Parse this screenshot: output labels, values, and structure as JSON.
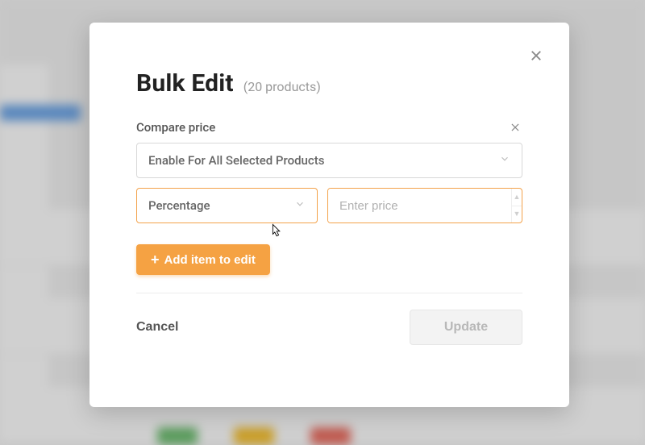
{
  "modal": {
    "title": "Bulk Edit",
    "subtitle": "(20 products)",
    "field_label": "Compare price",
    "select_main": "Enable For All Selected Products",
    "select_type": "Percentage",
    "price_placeholder": "Enter price",
    "add_item_label": "Add item to edit",
    "cancel_label": "Cancel",
    "update_label": "Update"
  }
}
